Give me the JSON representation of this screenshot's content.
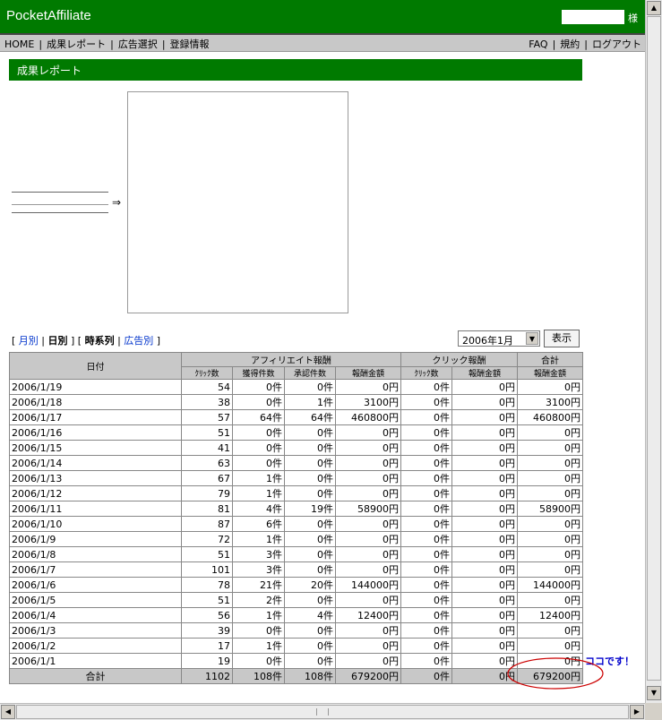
{
  "header": {
    "app_title": "PocketAffiliate",
    "user_suffix": "様"
  },
  "nav": {
    "left": [
      {
        "label": "HOME"
      },
      {
        "label": "成果レポート"
      },
      {
        "label": "広告選択"
      },
      {
        "label": "登録情報"
      }
    ],
    "right": [
      {
        "label": "FAQ"
      },
      {
        "label": "規約"
      },
      {
        "label": "ログアウト"
      }
    ]
  },
  "section": {
    "title": "成果レポート"
  },
  "arrow_symbol": "⇒",
  "view_links": {
    "open_bracket": "[ ",
    "monthly": "月別",
    "daily": "日別",
    "timeseries": "時系列",
    "by_ad": "広告別",
    "close_bracket": " ]",
    "separator": " | ",
    "bracket_sep": " ] [ "
  },
  "filter": {
    "selected_month": "2006年1月",
    "show_label": "表示"
  },
  "table": {
    "headers": {
      "date": "日付",
      "affiliate_group": "アフィリエイト報酬",
      "click_group": "クリック報酬",
      "total_group": "合計",
      "clicks": "ｸﾘｯｸ数",
      "acquired": "獲得件数",
      "approved": "承認件数",
      "reward": "報酬金額",
      "click_count": "ｸﾘｯｸ数",
      "click_reward": "報酬金額",
      "total_reward": "報酬金額"
    },
    "rows": [
      [
        "2006/1/19",
        "54",
        "0件",
        "0件",
        "0円",
        "0件",
        "0円",
        "0円"
      ],
      [
        "2006/1/18",
        "38",
        "0件",
        "1件",
        "3100円",
        "0件",
        "0円",
        "3100円"
      ],
      [
        "2006/1/17",
        "57",
        "64件",
        "64件",
        "460800円",
        "0件",
        "0円",
        "460800円"
      ],
      [
        "2006/1/16",
        "51",
        "0件",
        "0件",
        "0円",
        "0件",
        "0円",
        "0円"
      ],
      [
        "2006/1/15",
        "41",
        "0件",
        "0件",
        "0円",
        "0件",
        "0円",
        "0円"
      ],
      [
        "2006/1/14",
        "63",
        "0件",
        "0件",
        "0円",
        "0件",
        "0円",
        "0円"
      ],
      [
        "2006/1/13",
        "67",
        "1件",
        "0件",
        "0円",
        "0件",
        "0円",
        "0円"
      ],
      [
        "2006/1/12",
        "79",
        "1件",
        "0件",
        "0円",
        "0件",
        "0円",
        "0円"
      ],
      [
        "2006/1/11",
        "81",
        "4件",
        "19件",
        "58900円",
        "0件",
        "0円",
        "58900円"
      ],
      [
        "2006/1/10",
        "87",
        "6件",
        "0件",
        "0円",
        "0件",
        "0円",
        "0円"
      ],
      [
        "2006/1/9",
        "72",
        "1件",
        "0件",
        "0円",
        "0件",
        "0円",
        "0円"
      ],
      [
        "2006/1/8",
        "51",
        "3件",
        "0件",
        "0円",
        "0件",
        "0円",
        "0円"
      ],
      [
        "2006/1/7",
        "101",
        "3件",
        "0件",
        "0円",
        "0件",
        "0円",
        "0円"
      ],
      [
        "2006/1/6",
        "78",
        "21件",
        "20件",
        "144000円",
        "0件",
        "0円",
        "144000円"
      ],
      [
        "2006/1/5",
        "51",
        "2件",
        "0件",
        "0円",
        "0件",
        "0円",
        "0円"
      ],
      [
        "2006/1/4",
        "56",
        "1件",
        "4件",
        "12400円",
        "0件",
        "0円",
        "12400円"
      ],
      [
        "2006/1/3",
        "39",
        "0件",
        "0件",
        "0円",
        "0件",
        "0円",
        "0円"
      ],
      [
        "2006/1/2",
        "17",
        "1件",
        "0件",
        "0円",
        "0件",
        "0円",
        "0円"
      ],
      [
        "2006/1/1",
        "19",
        "0件",
        "0件",
        "0円",
        "0件",
        "0円",
        "0円"
      ]
    ],
    "total": [
      "合計",
      "1102",
      "108件",
      "108件",
      "679200円",
      "0件",
      "0円",
      "679200円"
    ]
  },
  "annotation": {
    "note": "ココです！",
    "color": "#cc0000"
  },
  "colors": {
    "brand_green": "#007a00",
    "nav_gray": "#c8c8c8",
    "link_blue": "#0033cc"
  }
}
